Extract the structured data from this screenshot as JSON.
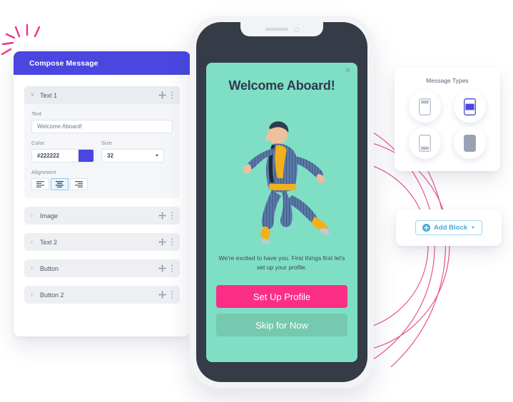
{
  "compose": {
    "header_title": "Compose Message",
    "open_block": {
      "title": "Text 1",
      "caret_icon": "chevron-down-icon",
      "move_icon": "move-handle-icon",
      "menu_icon": "kebab-menu-icon",
      "text_field": {
        "label": "Text",
        "value": "Welcome Aboard!"
      },
      "color_field": {
        "label": "Color",
        "value": "#222222",
        "swatch_color": "#4a46e0"
      },
      "size_field": {
        "label": "Size",
        "value": "32",
        "caret_icon": "chevron-down-icon"
      },
      "alignment": {
        "label": "Alignment",
        "options": [
          "align-left",
          "align-center",
          "align-right"
        ],
        "selected": "align-center"
      }
    },
    "blocks": [
      {
        "title": "Image",
        "caret_icon": "chevron-right-icon"
      },
      {
        "title": "Text 2",
        "caret_icon": "chevron-right-icon"
      },
      {
        "title": "Button",
        "caret_icon": "chevron-right-icon"
      },
      {
        "title": "Button 2",
        "caret_icon": "chevron-right-icon"
      }
    ]
  },
  "phone": {
    "screen": {
      "close_icon": "close-icon",
      "title": "Welcome Aboard!",
      "hero_alt": "jumping-man-illustration",
      "subtitle": "We're excited to have you. First things first let's set up your profile.",
      "primary_button": "Set Up Profile",
      "secondary_button": "Skip for Now",
      "bg_color": "#7fdfc4",
      "primary_color": "#fa2e87",
      "secondary_color": "#74c9ae"
    }
  },
  "message_types": {
    "title": "Message Types",
    "items": [
      {
        "name": "top-banner-type",
        "selected": false
      },
      {
        "name": "modal-type",
        "selected": true
      },
      {
        "name": "bottom-banner-type",
        "selected": false
      },
      {
        "name": "fullscreen-type",
        "selected": false
      }
    ],
    "accent_color": "#4a46e0"
  },
  "add_block": {
    "label": "Add Block",
    "plus_icon": "plus-circle-icon",
    "caret_icon": "chevron-down-icon",
    "accent_color": "#48a8d8"
  },
  "decor": {
    "sparkle_color": "#f0308b",
    "arc_color": "#e8558f"
  }
}
